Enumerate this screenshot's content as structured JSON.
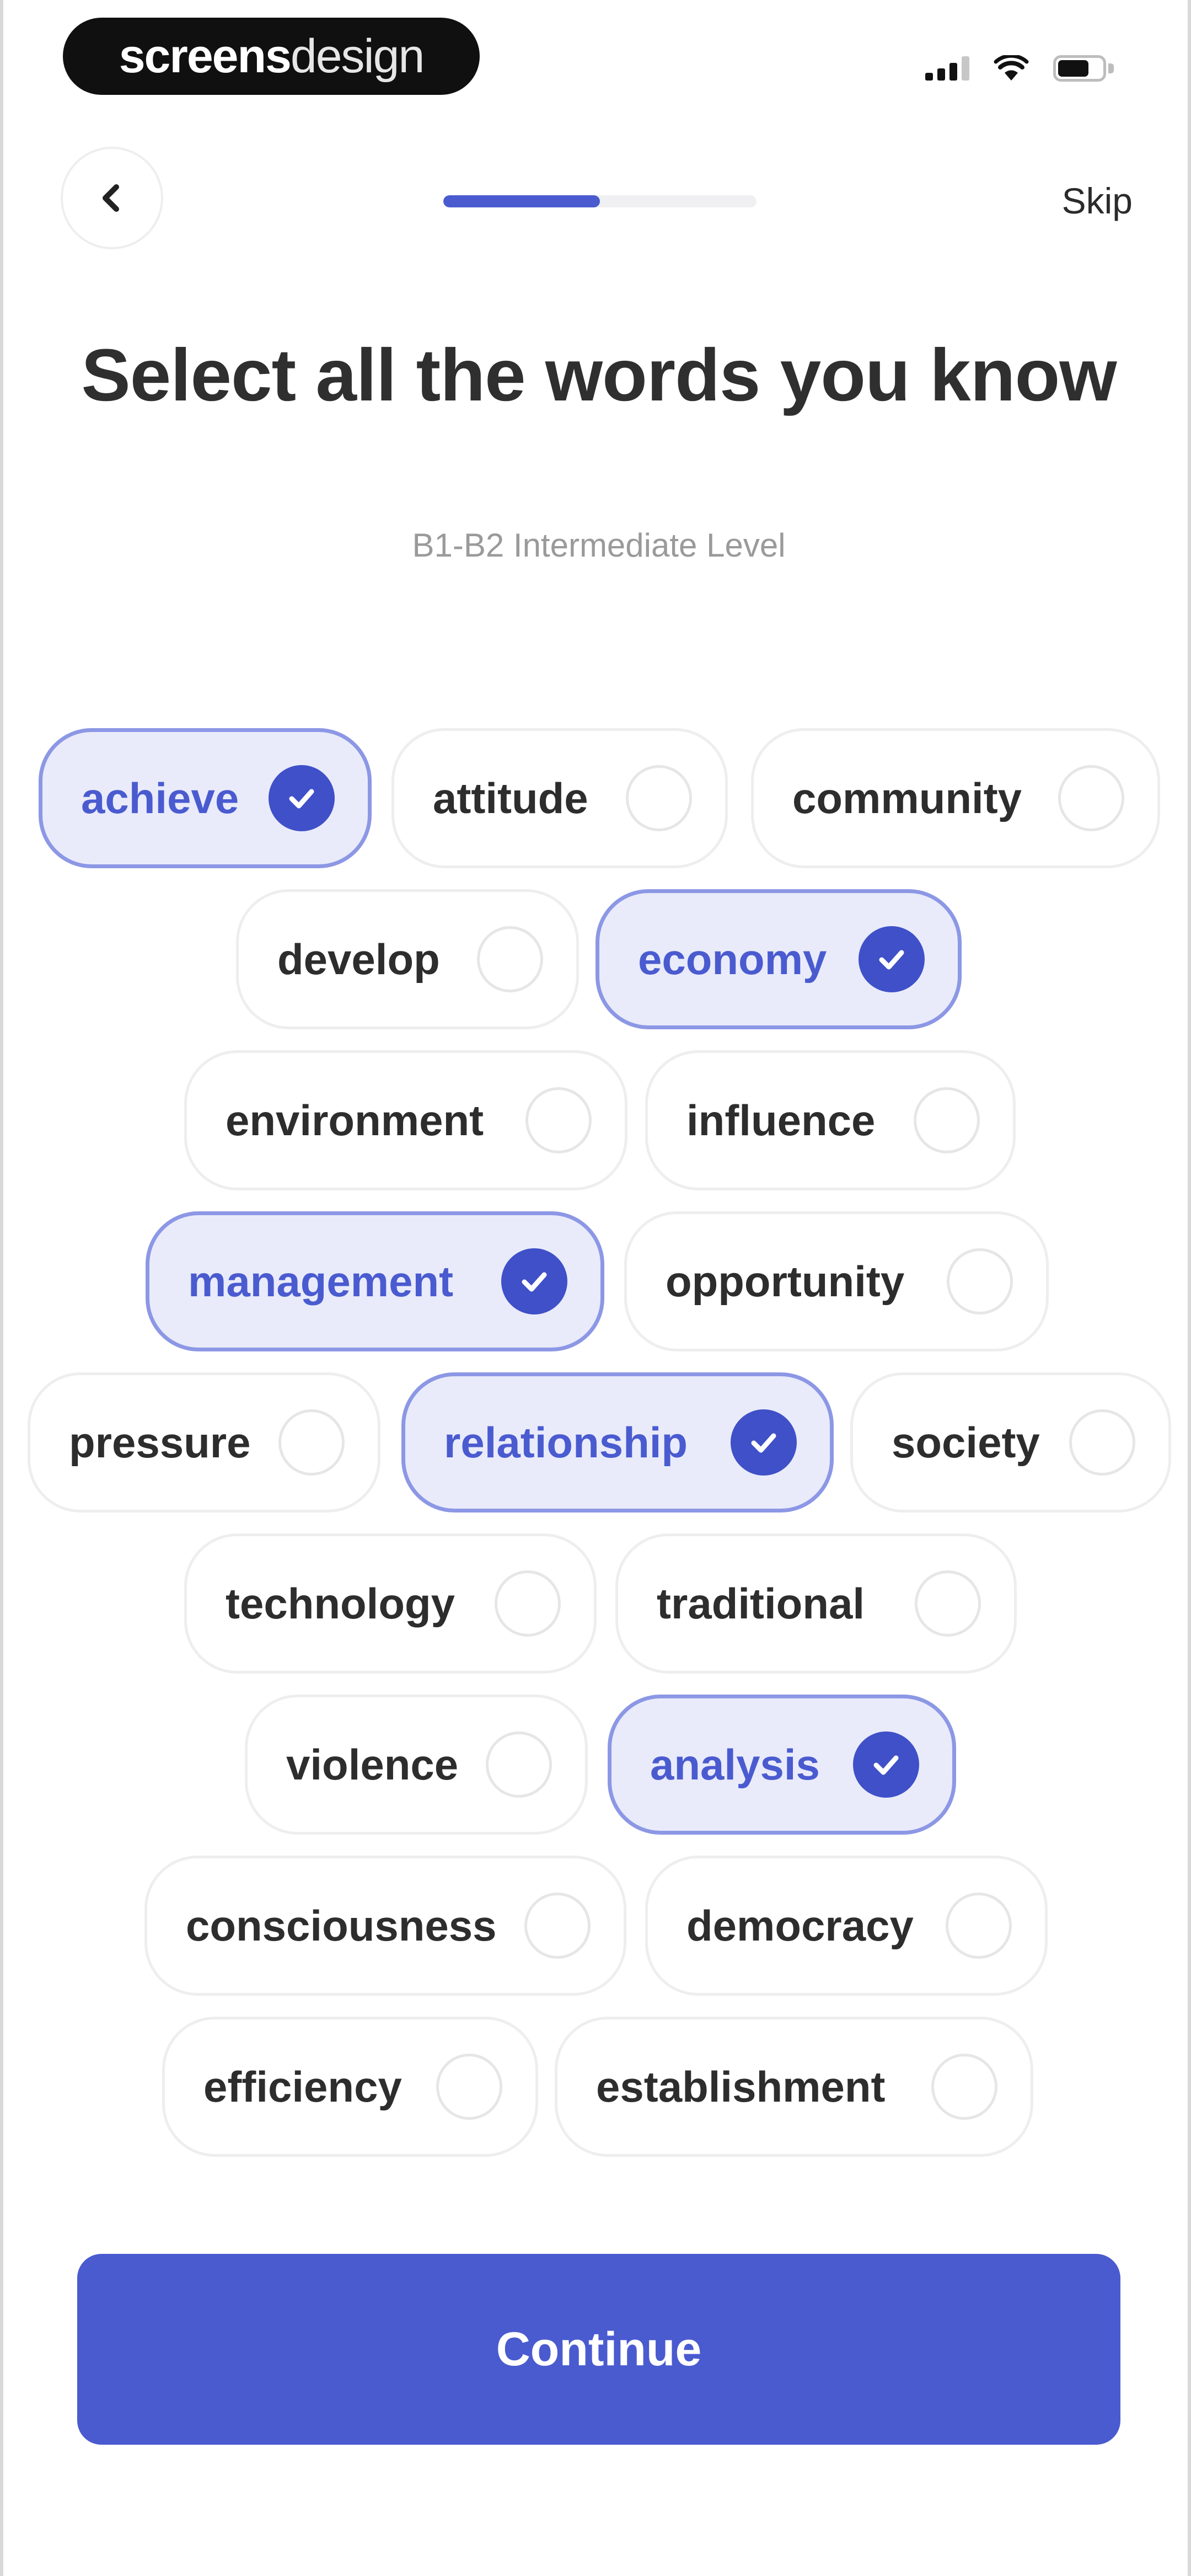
{
  "status_bar": {
    "brand_bold": "screens",
    "brand_light": "design",
    "battery_level": 0.7
  },
  "nav": {
    "back_icon": "chevron-left-icon",
    "skip_label": "Skip",
    "progress": 0.5
  },
  "header": {
    "title": "Select all the words you know",
    "subtitle": "B1-B2 Intermediate Level"
  },
  "words": [
    {
      "label": "achieve",
      "selected": true
    },
    {
      "label": "attitude",
      "selected": false
    },
    {
      "label": "community",
      "selected": false
    },
    {
      "label": "develop",
      "selected": false
    },
    {
      "label": "economy",
      "selected": true
    },
    {
      "label": "environment",
      "selected": false
    },
    {
      "label": "influence",
      "selected": false
    },
    {
      "label": "management",
      "selected": true
    },
    {
      "label": "opportunity",
      "selected": false
    },
    {
      "label": "pressure",
      "selected": false
    },
    {
      "label": "relationship",
      "selected": true
    },
    {
      "label": "society",
      "selected": false
    },
    {
      "label": "technology",
      "selected": false
    },
    {
      "label": "traditional",
      "selected": false
    },
    {
      "label": "violence",
      "selected": false
    },
    {
      "label": "analysis",
      "selected": true
    },
    {
      "label": "consciousness",
      "selected": false
    },
    {
      "label": "democracy",
      "selected": false
    },
    {
      "label": "efficiency",
      "selected": false
    },
    {
      "label": "establishment",
      "selected": false
    }
  ],
  "footer": {
    "continue_label": "Continue"
  },
  "colors": {
    "accent": "#4a5bd0",
    "selected_bg": "#e9ebfa",
    "selected_border": "#8c97e5"
  }
}
